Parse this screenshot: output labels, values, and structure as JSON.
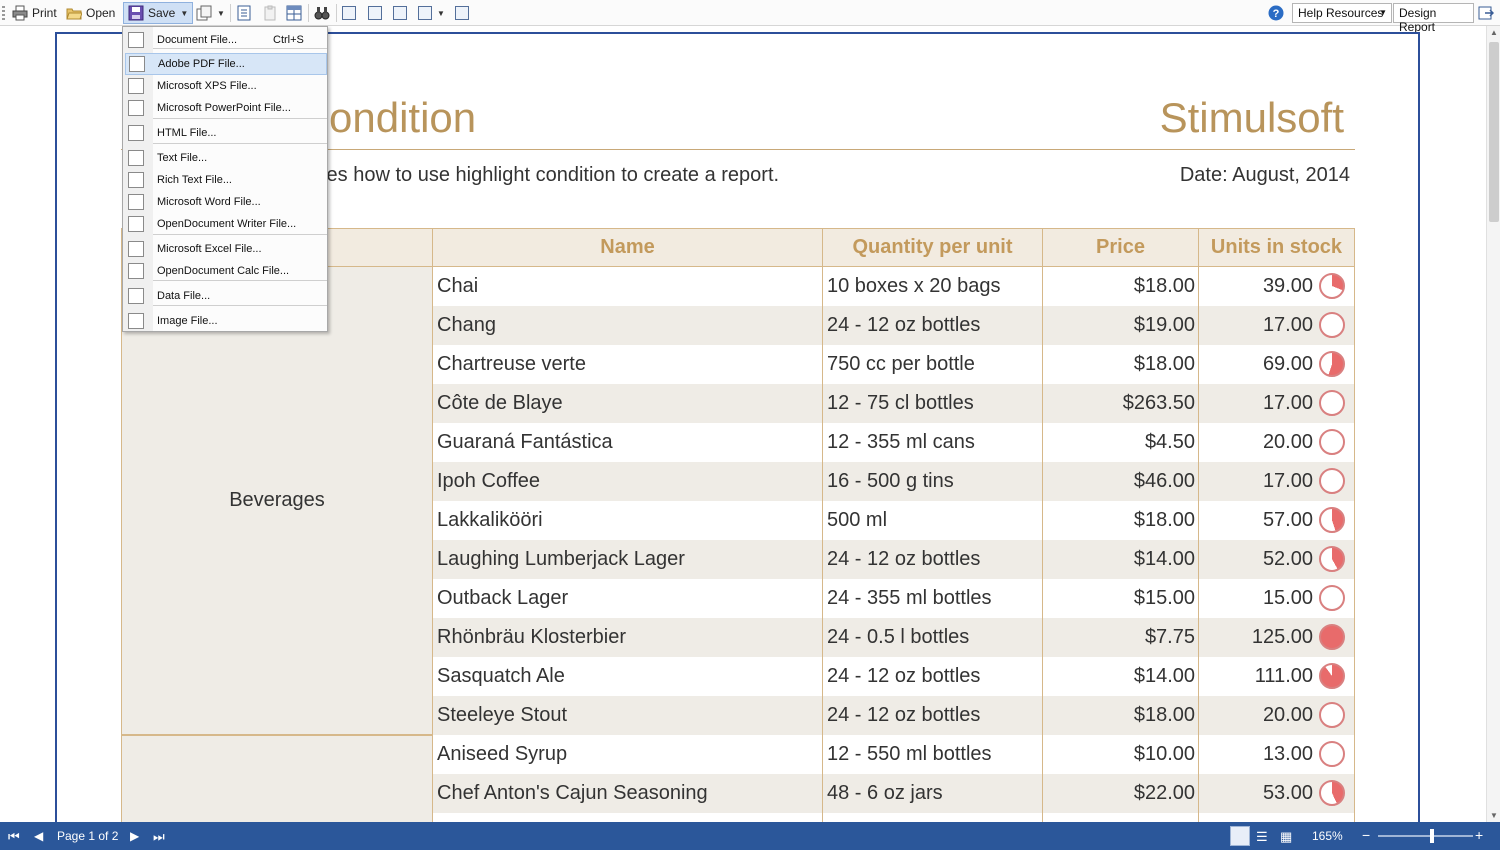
{
  "toolbar": {
    "print_label": "Print",
    "open_label": "Open",
    "save_label": "Save",
    "help_resources": "Help Resources",
    "design_report": "Design Report"
  },
  "save_menu": [
    {
      "label": "Document File...",
      "shortcut": "Ctrl+S",
      "icon": "document-file-icon"
    },
    {
      "label": "Adobe PDF File...",
      "icon": "pdf-file-icon"
    },
    {
      "label": "Microsoft XPS File...",
      "icon": "xps-file-icon"
    },
    {
      "label": "Microsoft PowerPoint File...",
      "icon": "ppt-file-icon"
    },
    {
      "label": "HTML File...",
      "icon": "html-file-icon"
    },
    {
      "label": "Text File...",
      "icon": "txt-file-icon"
    },
    {
      "label": "Rich Text File...",
      "icon": "rtf-file-icon"
    },
    {
      "label": "Microsoft Word File...",
      "icon": "doc-file-icon"
    },
    {
      "label": "OpenDocument Writer File...",
      "icon": "odt-file-icon"
    },
    {
      "label": "Microsoft Excel File...",
      "icon": "xls-file-icon"
    },
    {
      "label": "OpenDocument Calc File...",
      "icon": "ods-file-icon"
    },
    {
      "label": "Data File...",
      "icon": "dbf-file-icon"
    },
    {
      "label": "Image File...",
      "icon": "img-file-icon"
    }
  ],
  "report": {
    "title_visible": "ondition",
    "brand": "Stimulsoft",
    "subtitle_visible": "tes how to use highlight condition to create a report.",
    "date": "Date: August, 2014",
    "columns": {
      "name": "Name",
      "quantity": "Quantity per unit",
      "price": "Price",
      "stock": "Units in stock"
    },
    "category_1": "Beverages",
    "rows": [
      {
        "name": "Chai",
        "qty": "10 boxes x 20 bags",
        "price": "$18.00",
        "stock": "39.00",
        "level": 0.31
      },
      {
        "name": "Chang",
        "qty": "24 - 12 oz bottles",
        "price": "$19.00",
        "stock": "17.00",
        "level": 0.0
      },
      {
        "name": "Chartreuse verte",
        "qty": "750 cc per bottle",
        "price": "$18.00",
        "stock": "69.00",
        "level": 0.55
      },
      {
        "name": "Côte de Blaye",
        "qty": "12 - 75 cl bottles",
        "price": "$263.50",
        "stock": "17.00",
        "level": 0.0
      },
      {
        "name": "Guaraná Fantástica",
        "qty": "12 - 355 ml cans",
        "price": "$4.50",
        "stock": "20.00",
        "level": 0.0
      },
      {
        "name": "Ipoh Coffee",
        "qty": "16 - 500 g tins",
        "price": "$46.00",
        "stock": "17.00",
        "level": 0.0
      },
      {
        "name": "Lakkalikööri",
        "qty": "500 ml",
        "price": "$18.00",
        "stock": "57.00",
        "level": 0.45
      },
      {
        "name": "Laughing Lumberjack Lager",
        "qty": "24 - 12 oz bottles",
        "price": "$14.00",
        "stock": "52.00",
        "level": 0.42
      },
      {
        "name": "Outback Lager",
        "qty": "24 - 355 ml bottles",
        "price": "$15.00",
        "stock": "15.00",
        "level": 0.0
      },
      {
        "name": "Rhönbräu Klosterbier",
        "qty": "24 - 0.5 l bottles",
        "price": "$7.75",
        "stock": "125.00",
        "level": 1.0
      },
      {
        "name": "Sasquatch Ale",
        "qty": "24 - 12 oz bottles",
        "price": "$14.00",
        "stock": "111.00",
        "level": 0.9
      },
      {
        "name": "Steeleye Stout",
        "qty": "24 - 12 oz bottles",
        "price": "$18.00",
        "stock": "20.00",
        "level": 0.0
      },
      {
        "name": "Aniseed Syrup",
        "qty": "12 - 550 ml bottles",
        "price": "$10.00",
        "stock": "13.00",
        "level": 0.0
      },
      {
        "name": "Chef Anton's Cajun Seasoning",
        "qty": "48 - 6 oz jars",
        "price": "$22.00",
        "stock": "53.00",
        "level": 0.43
      }
    ]
  },
  "status": {
    "page_info": "Page 1 of 2",
    "zoom": "165%"
  },
  "colors": {
    "accent": "#b8945b",
    "header_text": "#c39a5c",
    "gauge": "#e86b6b",
    "status_bar": "#2b579a"
  }
}
